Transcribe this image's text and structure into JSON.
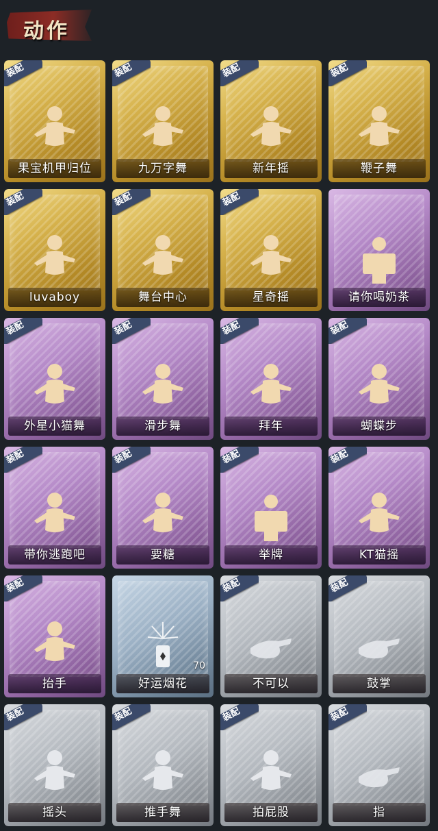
{
  "header": {
    "title": "动作"
  },
  "badge_label": "装配",
  "colors": {
    "gold": "#d6b24c",
    "purple": "#b58ac8",
    "silver": "#b5bac0",
    "blue": "#9bb0c4",
    "badge": "#3b4a6a"
  },
  "cards": [
    {
      "label": "果宝机甲归位",
      "rarity": "gold",
      "equipped": true,
      "icon": "dance-pose-icon"
    },
    {
      "label": "九万字舞",
      "rarity": "gold",
      "equipped": true,
      "icon": "dance-pose-icon"
    },
    {
      "label": "新年摇",
      "rarity": "gold",
      "equipped": true,
      "icon": "dance-pose-icon"
    },
    {
      "label": "鞭子舞",
      "rarity": "gold",
      "equipped": true,
      "icon": "dance-pose-icon"
    },
    {
      "label": "luvaboy",
      "rarity": "gold",
      "equipped": true,
      "icon": "dance-pose-icon"
    },
    {
      "label": "舞台中心",
      "rarity": "gold",
      "equipped": true,
      "icon": "dance-pose-icon"
    },
    {
      "label": "星奇摇",
      "rarity": "gold",
      "equipped": true,
      "icon": "dance-pose-icon"
    },
    {
      "label": "请你喝奶茶",
      "rarity": "purple",
      "equipped": false,
      "icon": "sign-pose-icon"
    },
    {
      "label": "外星小猫舞",
      "rarity": "purple",
      "equipped": true,
      "icon": "dance-pose-icon"
    },
    {
      "label": "滑步舞",
      "rarity": "purple",
      "equipped": true,
      "icon": "dance-pose-icon"
    },
    {
      "label": "拜年",
      "rarity": "purple",
      "equipped": true,
      "icon": "bow-pose-icon"
    },
    {
      "label": "蝴蝶步",
      "rarity": "purple",
      "equipped": true,
      "icon": "dance-pose-icon"
    },
    {
      "label": "带你逃跑吧",
      "rarity": "purple",
      "equipped": true,
      "icon": "dance-pose-icon"
    },
    {
      "label": "要糖",
      "rarity": "purple",
      "equipped": true,
      "icon": "reach-pose-icon"
    },
    {
      "label": "举牌",
      "rarity": "purple",
      "equipped": true,
      "icon": "sign-pose-icon"
    },
    {
      "label": "KT猫摇",
      "rarity": "purple",
      "equipped": true,
      "icon": "dance-pose-icon"
    },
    {
      "label": "抬手",
      "rarity": "purple",
      "equipped": true,
      "icon": "reach-pose-icon"
    },
    {
      "label": "好运烟花",
      "rarity": "blue",
      "equipped": false,
      "icon": "firework-icon",
      "count": "70"
    },
    {
      "label": "不可以",
      "rarity": "silver",
      "equipped": true,
      "icon": "finger-wag-icon"
    },
    {
      "label": "鼓掌",
      "rarity": "silver",
      "equipped": true,
      "icon": "clap-hands-icon"
    },
    {
      "label": "摇头",
      "rarity": "silver",
      "equipped": true,
      "icon": "dance-pose-icon"
    },
    {
      "label": "推手舞",
      "rarity": "silver",
      "equipped": true,
      "icon": "dance-pose-icon"
    },
    {
      "label": "拍屁股",
      "rarity": "silver",
      "equipped": true,
      "icon": "bow-pose-icon"
    },
    {
      "label": "指",
      "rarity": "silver",
      "equipped": true,
      "icon": "point-hand-icon"
    }
  ]
}
